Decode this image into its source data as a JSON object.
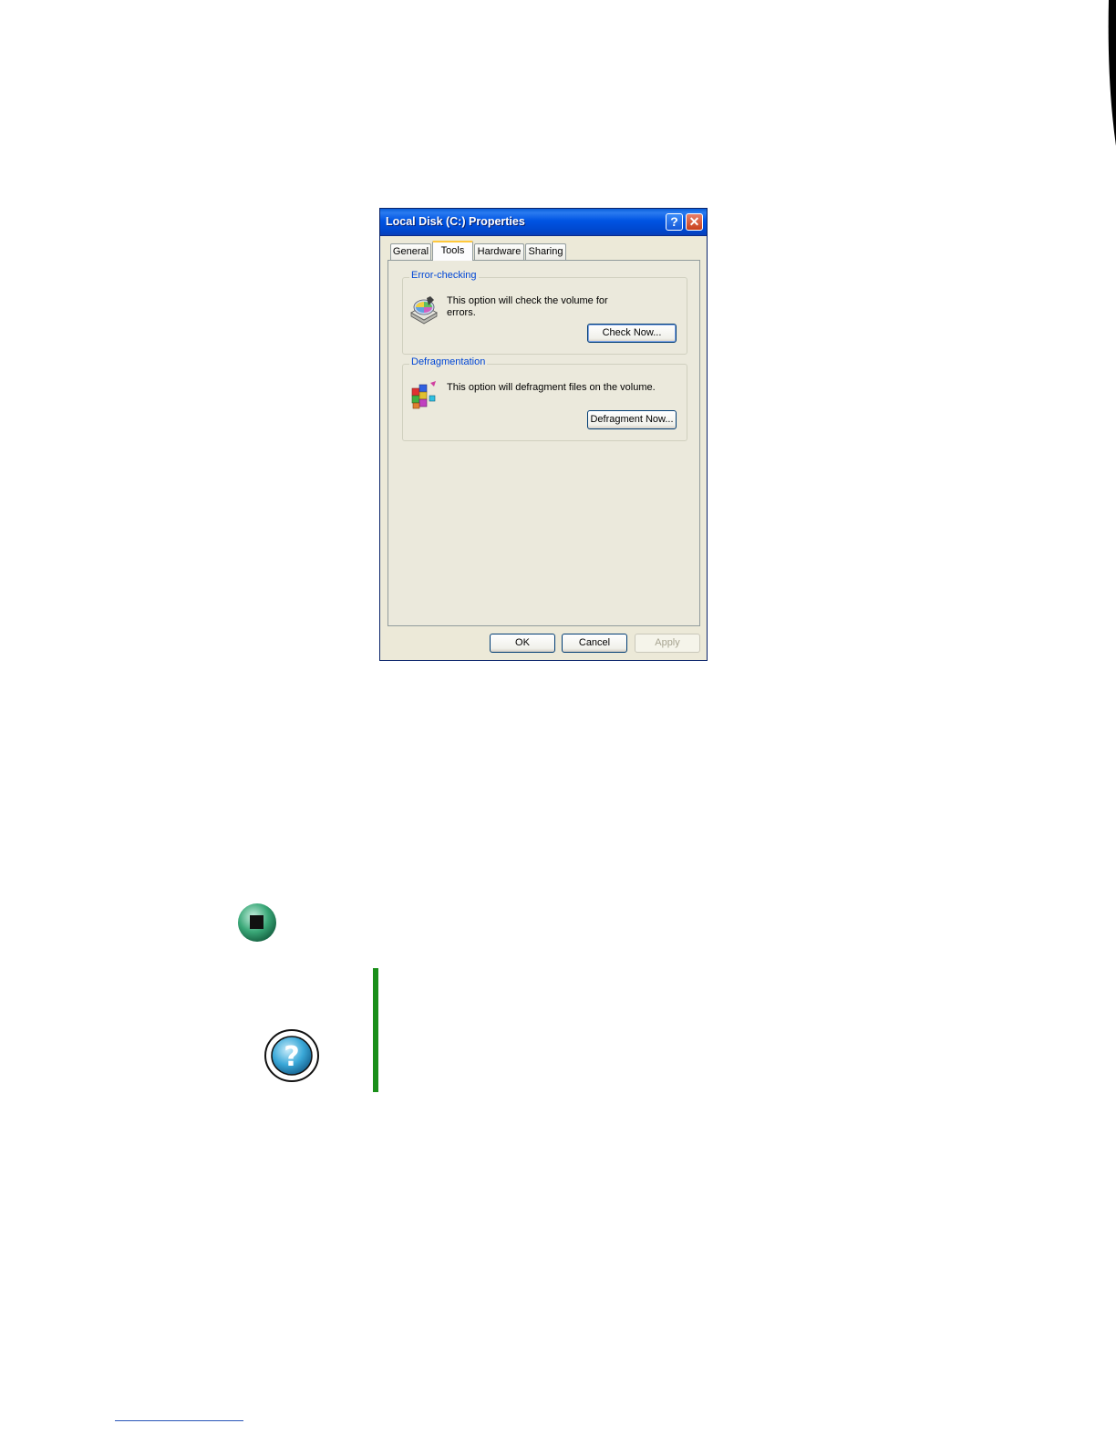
{
  "dialog": {
    "title": "Local Disk (C:) Properties",
    "help_button": "?",
    "close_button": "✕",
    "tabs": [
      {
        "label": "General",
        "active": false
      },
      {
        "label": "Tools",
        "active": true
      },
      {
        "label": "Hardware",
        "active": false
      },
      {
        "label": "Sharing",
        "active": false
      }
    ],
    "error_checking": {
      "title": "Error-checking",
      "text_line1": "This option will check the volume for",
      "text_line2": "errors.",
      "button": "Check Now..."
    },
    "defragmentation": {
      "title": "Defragmentation",
      "text": "This option will defragment files on the volume.",
      "button": "Defragment Now..."
    },
    "buttons": {
      "ok": "OK",
      "cancel": "Cancel",
      "apply": "Apply"
    }
  },
  "colors": {
    "titlebar": "#0054e3",
    "dialog_bg": "#ece9d8",
    "group_title": "#0046d5",
    "tip_rule": "#1a8f1a"
  },
  "icons": {
    "stop": "stop-icon",
    "help": "help-icon",
    "error_check": "disk-check-icon",
    "defrag": "defragment-icon"
  }
}
